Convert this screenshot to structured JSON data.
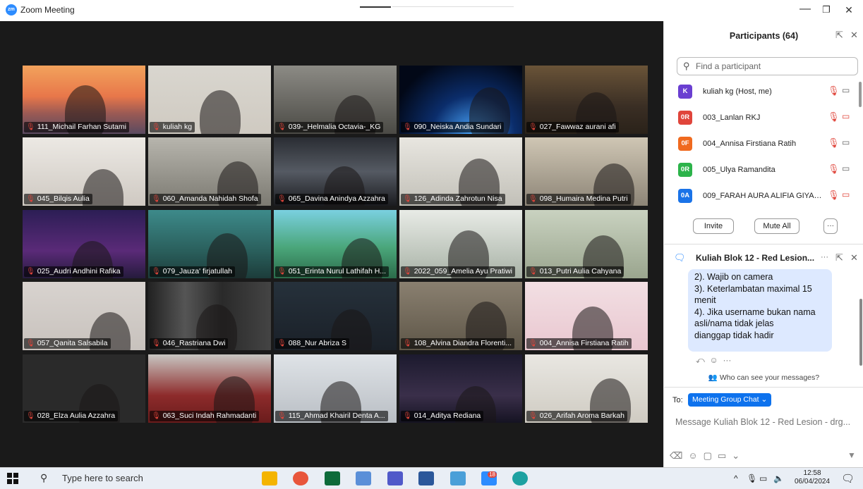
{
  "window": {
    "title": "Zoom Meeting",
    "app_icon_text": "zm",
    "minimize": "—",
    "restore": "❐",
    "close": "✕"
  },
  "tiles": [
    {
      "name": "111_Michail Farhan Sutami",
      "bg": "linear-gradient(180deg,#f2a35c 0%,#e8774a 45%,#9b5a54 70%,#5a4a60 100%)",
      "active": false
    },
    {
      "name": "kuliah kg",
      "bg": "linear-gradient(180deg,#d9d6cf 0%,#cfcac1 100%)",
      "active": true
    },
    {
      "name": "039-_Helmalia Octavia-_KG",
      "bg": "linear-gradient(180deg,#8c8b85 0%,#4b4a45 100%)",
      "active": false
    },
    {
      "name": "090_Neiska Andia Sundari",
      "bg": "radial-gradient(ellipse at 60% 100%,#4aa8ff 0%,#0b2d6b 40%,#020817 80%)",
      "active": false
    },
    {
      "name": "027_Fawwaz aurani afi",
      "bg": "linear-gradient(180deg,#6a5438 0%,#3a2e24 60%,#2a2219 100%)",
      "active": false
    },
    {
      "name": "045_Bilqis Aulia",
      "bg": "linear-gradient(180deg,#ece9e4 0%,#cfc9c2 100%)",
      "active": false
    },
    {
      "name": "060_Amanda Nahidah Shofa",
      "bg": "linear-gradient(180deg,#b7b5ad 0%,#7c7a72 100%)",
      "active": false
    },
    {
      "name": "065_Davina Anindya Azzahra",
      "bg": "linear-gradient(180deg,#2a2d33 0%,#555a63 50%,#1b1c20 100%)",
      "active": false
    },
    {
      "name": "126_Adinda Zahrotun Nisa",
      "bg": "linear-gradient(180deg,#e8e6e0 0%,#c2c0b8 100%)",
      "active": false
    },
    {
      "name": "098_Humaira Medina Putri",
      "bg": "linear-gradient(180deg,#cfc6b4 0%,#8d8577 100%)",
      "active": false
    },
    {
      "name": "025_Audri Andhini Rafika",
      "bg": "linear-gradient(180deg,#2c1e55 0%,#5a2a78 60%,#251b3c 100%)",
      "active": false
    },
    {
      "name": "079_Jauza' firjatullah",
      "bg": "linear-gradient(180deg,#3d8a8a 0%,#2a5f5c 60%,#1c3c3a 100%)",
      "active": false
    },
    {
      "name": "051_Erinta Nurul Lathifah H...",
      "bg": "linear-gradient(180deg,#7ad0e0 0%,#4aa67a 55%,#2b6b4a 100%)",
      "active": false
    },
    {
      "name": "2022_059_Amelia Ayu Pratiwi",
      "bg": "linear-gradient(180deg,#e8ebe6 0%,#a8b2a6 100%)",
      "active": false
    },
    {
      "name": "013_Putri Aulia Cahyana",
      "bg": "linear-gradient(180deg,#c9d2c0 0%,#9aa58e 100%)",
      "active": false
    },
    {
      "name": "057_Qanita Salsabila",
      "bg": "linear-gradient(180deg,#d8d3cf 0%,#c8c2bd 100%)",
      "active": false
    },
    {
      "name": "046_Rastriana Dwi",
      "bg": "linear-gradient(90deg,#222 0%,#555 30%,#2a2a2a 60%,#444 100%)",
      "active": false
    },
    {
      "name": "088_Nur Abriza S",
      "bg": "linear-gradient(180deg,#26313b 0%,#1a2028 100%)",
      "active": false
    },
    {
      "name": "108_Alvina Diandra Florenti...",
      "bg": "linear-gradient(180deg,#8a8070 0%,#5e5648 100%)",
      "active": false
    },
    {
      "name": "004_Annisa Firstiana Ratih",
      "bg": "linear-gradient(180deg,#f2dfe3 0%,#e9c7d0 100%)",
      "active": false
    },
    {
      "name": "028_Elza Aulia Azzahra",
      "bg": "linear-gradient(180deg,#2a2a2a 0%,#2a2a2a 100%)",
      "active": false
    },
    {
      "name": "063_Suci Indah Rahmadanti",
      "bg": "linear-gradient(180deg,#c8c6c2 0%,#8d2b2b 60%,#6a1c1c 100%)",
      "active": false
    },
    {
      "name": "115_Ahmad Khairil Denta A...",
      "bg": "linear-gradient(180deg,#dfe3e7 0%,#b9bec4 100%)",
      "active": false
    },
    {
      "name": "014_Aditya Rediana",
      "bg": "linear-gradient(180deg,#1c1a2e 0%,#3a2f4a 60%,#151322 100%)",
      "active": false
    },
    {
      "name": "026_Arifah Aroma Barkah",
      "bg": "linear-gradient(180deg,#e9e7e2 0%,#cfcbc2 100%)",
      "active": false
    }
  ],
  "participants": {
    "title": "Participants (64)",
    "search_placeholder": "Find a participant",
    "list": [
      {
        "initials": "K",
        "name": "kuliah kg (Host, me)",
        "color": "#6a3fd1",
        "cam_off": false
      },
      {
        "initials": "0R",
        "name": "003_Lanlan RKJ",
        "color": "#e0453b",
        "cam_off": true
      },
      {
        "initials": "0F",
        "name": "004_Annisa Firstiana Ratih",
        "color": "#f06a1f",
        "cam_off": false
      },
      {
        "initials": "0R",
        "name": "005_Ulya Ramandita",
        "color": "#2cb34a",
        "cam_off": false
      },
      {
        "initials": "0A",
        "name": "009_FARAH AURA ALIFIA GIYAN...",
        "color": "#1a73e8",
        "cam_off": true
      }
    ],
    "invite_label": "Invite",
    "mute_all_label": "Mute All",
    "more_label": "···"
  },
  "chat": {
    "title": "Kuliah Blok 12 - Red Lesion...",
    "message_lines": [
      "2). Wajib on camera",
      "3). Keterlambatan maximal 15",
      "menit",
      "4). Jika username bukan nama",
      "asli/nama tidak jelas",
      "dianggap tidak hadir"
    ],
    "who_can_see": "Who can see your messages?",
    "to_label": "To:",
    "to_target": "Meeting Group Chat",
    "input_placeholder": "Message Kuliah Blok 12 - Red Lesion - drg..."
  },
  "taskbar": {
    "search_text": "Type here to search",
    "time": "12:58",
    "date": "06/04/2024",
    "zoom_badge": "18"
  }
}
